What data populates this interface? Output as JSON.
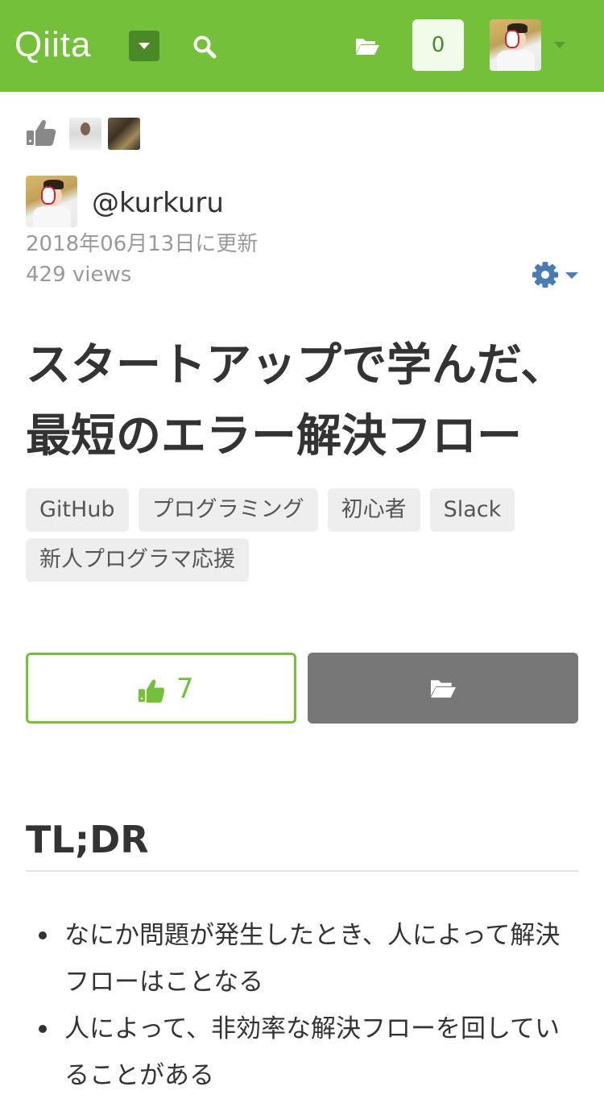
{
  "header": {
    "logo": "Qiita",
    "notification_count": "0",
    "brand_color": "#74c03a"
  },
  "article": {
    "author": "@kurkuru",
    "updated": "2018年06月13日に更新",
    "views": "429 views",
    "title_line1": "スタートアップで学んだ、",
    "title_line2": "最短のエラー解決フロー",
    "tags": [
      "GitHub",
      "プログラミング",
      "初心者",
      "Slack",
      "新人プログラマ応援"
    ],
    "like_count": "7"
  },
  "body": {
    "heading": "TL;DR",
    "bullets": [
      "なにか問題が発生したとき、人によって解決フローはことなる",
      "人によって、非効率な解決フローを回していることがある"
    ]
  },
  "icons": {
    "search": "search-icon",
    "folder": "folder-open-icon",
    "like": "thumbs-up-icon",
    "settings": "gear-icon"
  }
}
